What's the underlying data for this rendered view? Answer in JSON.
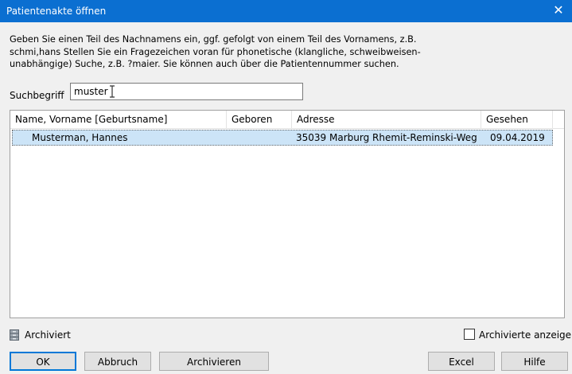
{
  "window": {
    "title": "Patientenakte öffnen",
    "close_glyph": "✕"
  },
  "description": {
    "line1": "Geben Sie einen Teil des Nachnamens ein, ggf. gefolgt von einem Teil des Vornamens, z.B.",
    "line2": "schmi,hans Stellen Sie ein Fragezeichen voran für phonetische (klangliche, schweibweisen-",
    "line3": "unabhängige) Suche, z.B. ?maier. Sie können auch über die Patientennummer suchen."
  },
  "search": {
    "label": "Suchbegriff",
    "value": "muster"
  },
  "table": {
    "columns": [
      "Name, Vorname [Geburtsname]",
      "Geboren",
      "Adresse",
      "Gesehen"
    ],
    "rows": [
      {
        "name": "Musterman, Hannes",
        "born": "",
        "address": "35039 Marburg Rhemit-Reminski-Weg ...",
        "seen": "09.04.2019",
        "selected": true
      }
    ]
  },
  "legend": {
    "archived_label": "Archiviert",
    "archived_icon": "archive-cabinet-icon"
  },
  "show_archived": {
    "label": "Archivierte anzeigen",
    "checked": false
  },
  "buttons": {
    "ok": "OK",
    "cancel": "Abbruch",
    "archive": "Archivieren",
    "excel": "Excel",
    "help": "Hilfe"
  },
  "colors": {
    "titlebar": "#0b6fd1",
    "selection": "#cce4f7"
  }
}
